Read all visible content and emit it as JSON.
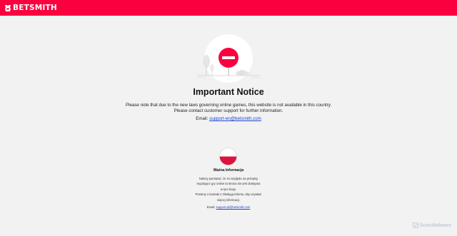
{
  "header": {
    "brand_name": "BETSMITH",
    "brand_color": "#fb003f"
  },
  "icons": {
    "logo": "betsmith-logo-icon",
    "hero": "no-entry-sign-icon",
    "flag": "poland-flag-icon",
    "watermark": "scanmalware-icon"
  },
  "notice": {
    "title": "Important Notice",
    "line1": "Please note that due to the new laws governing online games, this website is not available in this country.",
    "line2": "Please contact customer support for further information.",
    "email_label": "Email:",
    "email": "support-en@betsmith.com"
  },
  "polish_notice": {
    "title": "Ważna Informacja",
    "lines": [
      "Należy pamiętać, że ze względu na przepisy",
      "regulujące gry online ta strona nie jest dostępna",
      "w tym kraju.",
      "Prosimy o kontakt z Obsługą Klienta, aby uzyskać",
      "więcej informacji."
    ],
    "email_label": "Email:",
    "email": "support-pl@betsmith.com"
  },
  "watermark": {
    "text": "ScanMalware"
  }
}
